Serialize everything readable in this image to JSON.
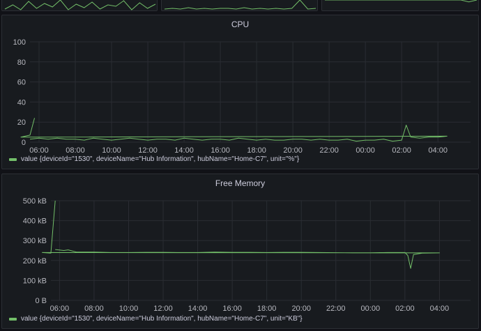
{
  "colors": {
    "background": "#111217",
    "panel": "#181b1f",
    "series": "#73bf69",
    "grid": "#2a2d33"
  },
  "top_sparklines": [
    {
      "values": [
        3,
        9,
        2,
        14,
        4,
        11,
        6,
        16,
        2,
        10,
        5,
        13,
        3,
        9,
        7,
        15,
        2,
        12,
        4,
        10
      ]
    },
    {
      "values": [
        3,
        4,
        3,
        5,
        3,
        4,
        3,
        4,
        4,
        3,
        5,
        3,
        4,
        3,
        4,
        3,
        4,
        16,
        3,
        4
      ]
    },
    {
      "values": [
        6,
        6,
        6,
        6,
        6,
        6,
        6,
        6,
        6,
        6,
        6,
        6,
        6,
        6,
        6,
        6,
        6,
        6,
        5,
        6
      ]
    }
  ],
  "panels": [
    {
      "title": "CPU",
      "legend": "value {deviceId=\"1530\", deviceName=\"Hub Information\", hubName=\"Home-C7\", unit=\"%\"}"
    },
    {
      "title": "Free Memory",
      "legend": "value {deviceId=\"1530\", deviceName=\"Hub Information\", hubName=\"Home-C7\", unit=\"KB\"}"
    }
  ],
  "chart_data": [
    {
      "type": "line",
      "title": "CPU",
      "xlabel": "",
      "ylabel": "",
      "ylim": [
        0,
        100
      ],
      "yticks": [
        "0",
        "20",
        "40",
        "60",
        "80",
        "100"
      ],
      "xticks": [
        "06:00",
        "08:00",
        "10:00",
        "12:00",
        "14:00",
        "16:00",
        "18:00",
        "20:00",
        "22:00",
        "00:00",
        "02:00",
        "04:00"
      ],
      "x_range_hours": [
        5.5,
        29.8
      ],
      "grid": true,
      "legend_position": "bottom-left",
      "series": [
        {
          "name": "value {deviceId=\"1530\", deviceName=\"Hub Information\", hubName=\"Home-C7\", unit=\"%\"}",
          "x": [
            "05:30",
            "06:00",
            "06:30",
            "07:00",
            "07:30",
            "08:00",
            "08:30",
            "09:00",
            "09:30",
            "10:00",
            "10:30",
            "11:00",
            "11:30",
            "12:00",
            "12:30",
            "13:00",
            "13:30",
            "14:00",
            "14:30",
            "15:00",
            "15:30",
            "16:00",
            "16:30",
            "17:00",
            "17:30",
            "18:00",
            "18:30",
            "19:00",
            "19:30",
            "20:00",
            "20:30",
            "21:00",
            "21:30",
            "22:00",
            "22:30",
            "23:00",
            "23:30",
            "00:00",
            "00:30",
            "01:00",
            "01:30",
            "02:00",
            "02:15",
            "02:30",
            "03:00",
            "03:30",
            "04:00",
            "04:30",
            "05:00",
            "05:30",
            "05:45"
          ],
          "y": [
            3,
            4,
            3,
            4,
            3,
            3,
            2,
            4,
            3,
            2,
            3,
            4,
            3,
            2,
            3,
            3,
            2,
            4,
            3,
            2,
            3,
            3,
            2,
            4,
            3,
            2,
            3,
            2,
            2,
            3,
            3,
            2,
            3,
            2,
            2,
            3,
            1,
            2,
            2,
            3,
            1,
            2,
            17,
            5,
            4,
            5,
            5,
            6,
            5,
            7,
            24
          ]
        }
      ]
    },
    {
      "type": "line",
      "title": "Free Memory",
      "xlabel": "",
      "ylabel": "",
      "ylim": [
        0,
        500
      ],
      "yunit": "kB",
      "yticks": [
        "0 B",
        "100 kB",
        "200 kB",
        "300 kB",
        "400 kB",
        "500 kB"
      ],
      "xticks": [
        "06:00",
        "08:00",
        "10:00",
        "12:00",
        "14:00",
        "16:00",
        "18:00",
        "20:00",
        "22:00",
        "00:00",
        "02:00",
        "04:00"
      ],
      "x_range_hours": [
        5.5,
        29.8
      ],
      "grid": true,
      "legend_position": "bottom-left",
      "series": [
        {
          "name": "value {deviceId=\"1530\", deviceName=\"Hub Information\", hubName=\"Home-C7\", unit=\"KB\"}",
          "x": [
            "05:45",
            "06:15",
            "06:30",
            "07:00",
            "08:00",
            "09:00",
            "10:00",
            "11:00",
            "12:00",
            "13:00",
            "14:00",
            "15:00",
            "16:00",
            "17:00",
            "18:00",
            "19:00",
            "20:00",
            "21:00",
            "22:00",
            "23:00",
            "00:00",
            "01:00",
            "02:00",
            "02:10",
            "02:20",
            "02:30",
            "03:00",
            "04:00",
            "05:00",
            "05:30",
            "05:45"
          ],
          "y": [
            255,
            250,
            253,
            242,
            242,
            240,
            240,
            241,
            241,
            240,
            240,
            242,
            241,
            241,
            240,
            241,
            241,
            240,
            239,
            238,
            238,
            240,
            240,
            225,
            160,
            230,
            237,
            238,
            240,
            237,
            500
          ]
        }
      ]
    }
  ]
}
